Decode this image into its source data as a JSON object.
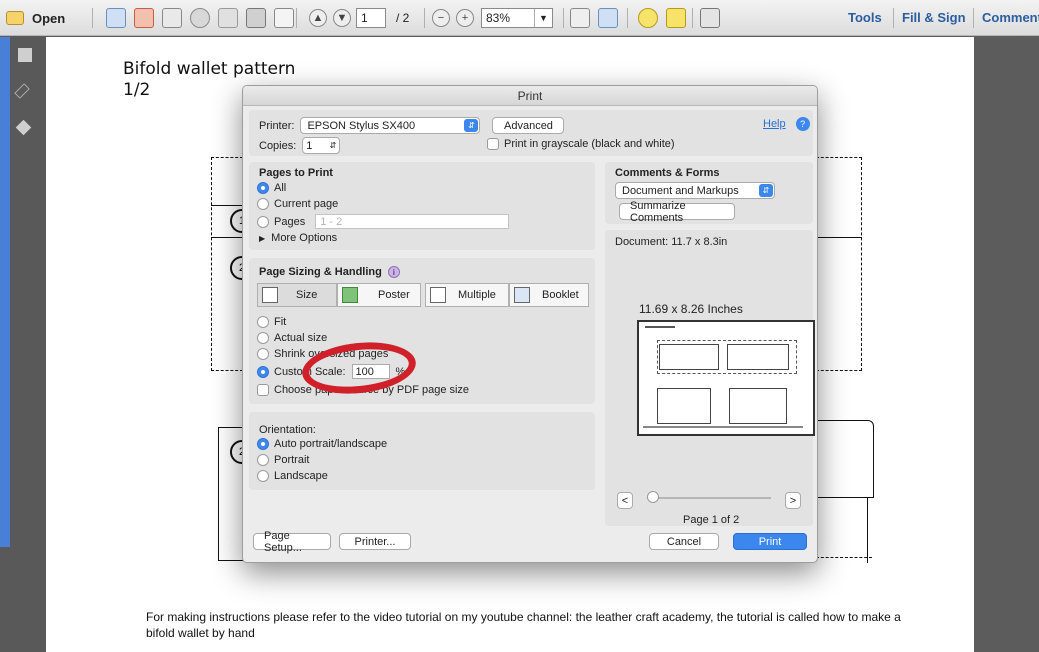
{
  "toolbar": {
    "open_label": "Open",
    "page_current": "1",
    "page_total": "/ 2",
    "zoom": "83%",
    "tools_label": "Tools",
    "fill_sign_label": "Fill & Sign",
    "comment_label": "Comment"
  },
  "document": {
    "title_line1": "Bifold wallet pattern",
    "title_line2": "1/2",
    "footer": "For making instructions please refer to the video tutorial on my youtube channel: the leather craft academy, the tutorial is called how to make a bifold wallet by hand",
    "pattern_numbers": [
      "1",
      "2",
      "2"
    ]
  },
  "dialog": {
    "title": "Print",
    "printer_label": "Printer:",
    "printer_value": "EPSON Stylus SX400",
    "advanced_label": "Advanced",
    "help_label": "Help",
    "copies_label": "Copies:",
    "copies_value": "1",
    "grayscale_label": "Print in grayscale (black and white)",
    "pages_to_print": {
      "heading": "Pages to Print",
      "options": [
        "All",
        "Current page",
        "Pages"
      ],
      "selected": "All",
      "pages_placeholder": "1 - 2",
      "more_options": "More Options"
    },
    "comments_forms": {
      "heading": "Comments & Forms",
      "value": "Document and Markups",
      "summarize_label": "Summarize Comments"
    },
    "document_size": "Document: 11.7 x 8.3in",
    "preview_size": "11.69 x 8.26 Inches",
    "page_sizing": {
      "heading": "Page Sizing & Handling",
      "tabs": [
        "Size",
        "Poster",
        "Multiple",
        "Booklet"
      ],
      "selected_tab": "Size",
      "options": [
        "Fit",
        "Actual size",
        "Shrink oversized pages",
        "Custom Scale:"
      ],
      "selected": "Custom Scale:",
      "scale_value": "100",
      "scale_unit": "%",
      "paper_source_label": "Choose paper source by PDF page size"
    },
    "orientation": {
      "heading": "Orientation:",
      "options": [
        "Auto portrait/landscape",
        "Portrait",
        "Landscape"
      ],
      "selected": "Auto portrait/landscape"
    },
    "pager": {
      "prev": "<",
      "next": ">",
      "label": "Page 1 of 2",
      "position": 0
    },
    "footer_buttons": {
      "page_setup": "Page Setup...",
      "printer": "Printer...",
      "cancel": "Cancel",
      "print": "Print"
    }
  },
  "colors": {
    "accent": "#3b87ee",
    "annotation_red": "#d0202a",
    "link": "#2c5d9e"
  }
}
